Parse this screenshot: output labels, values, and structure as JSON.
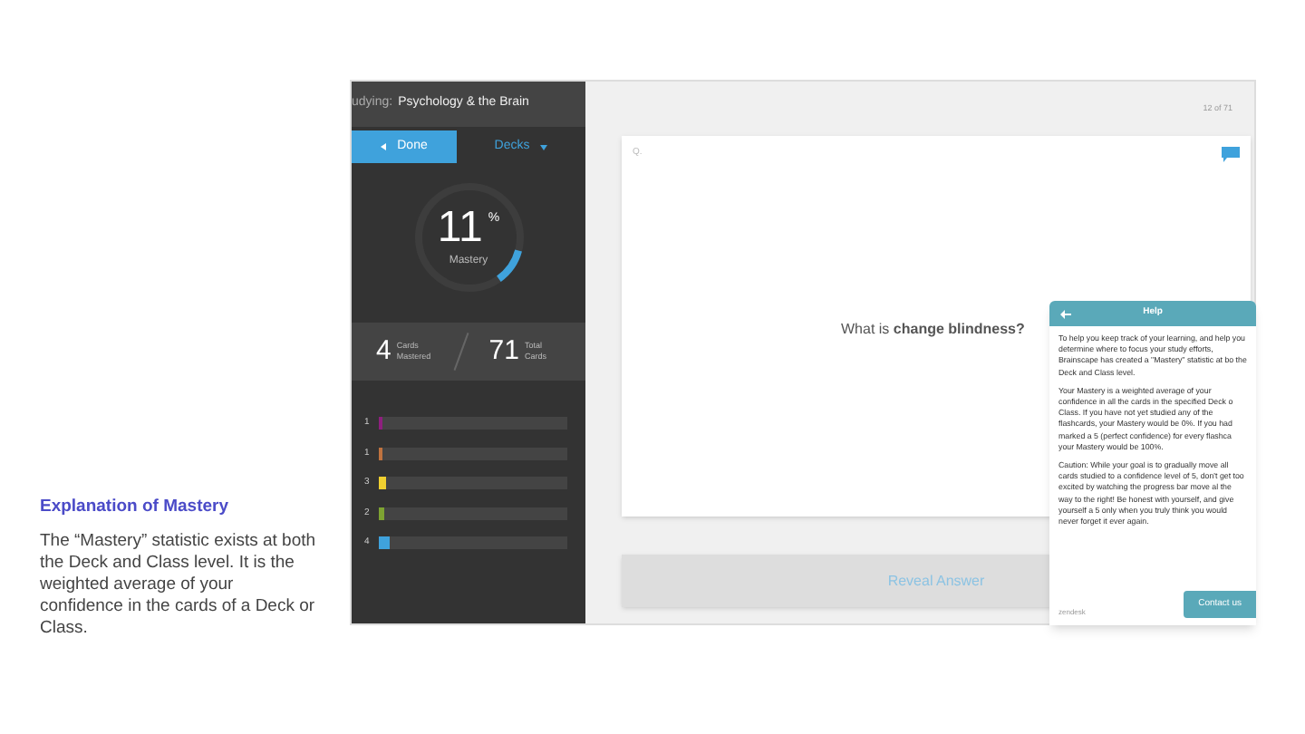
{
  "caption": {
    "title": "Explanation of Mastery",
    "text": "The “Mastery” statistic exists at both the Deck and Class level. It is the weighted average of your confidence in the cards of a Deck or Class."
  },
  "sidebar": {
    "studying_label": "udying:",
    "deck_title": "Psychology & the Brain",
    "done_button": "Done",
    "decks_button": "Decks",
    "mastery": {
      "value": "11",
      "unit": "%",
      "label": "Mastery",
      "level": 0.11
    },
    "stats": [
      {
        "value": "4",
        "label": "Cards Mastered"
      },
      {
        "value": "71",
        "label": "Total Cards"
      }
    ],
    "confidence_bars": [
      {
        "label": "1",
        "color": "#8e1f7e",
        "level": 0.014
      },
      {
        "label": "1",
        "color": "#c0733f",
        "level": 0.014
      },
      {
        "label": "3",
        "color": "#f0d030",
        "level": 0.042
      },
      {
        "label": "2",
        "color": "#7ea332",
        "level": 0.028
      },
      {
        "label": "4",
        "color": "#3fa2dc",
        "level": 0.056
      }
    ]
  },
  "card": {
    "counter": "12 of 71",
    "side_label": "Q.",
    "question": "What is **change blindness?**",
    "reveal_button": "Reveal Answer"
  },
  "help": {
    "title": "Help",
    "paragraphs": [
      "To help you keep track of your learning, and help you determine where to focus your study efforts, Brainscape has created a \"Mastery\" statistic at bo the Deck and Class level.",
      "Your Mastery is a weighted average of your confidence in all the cards in the specified Deck o Class. If you have not yet studied any of the flashcards, your Mastery would be 0%. If you had marked a 5 (perfect confidence) for every flashca your Mastery would be 100%.",
      "Caution: While your goal is to gradually move all cards studied to a confidence level of 5, don't get too excited by watching the progress bar move al the way to the right! Be honest with yourself, and give yourself a 5 only when you truly think you would never forget it ever again."
    ],
    "footer": "zendesk",
    "contact_button": "Contact us"
  }
}
